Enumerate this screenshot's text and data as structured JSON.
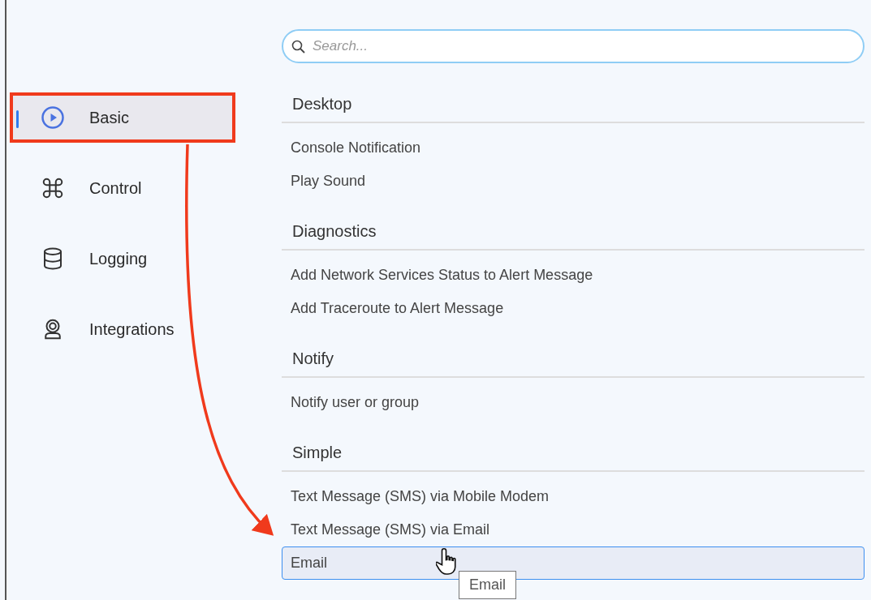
{
  "search": {
    "placeholder": "Search..."
  },
  "sidebar": {
    "items": [
      {
        "label": "Basic",
        "selected": true,
        "highlighted": true
      },
      {
        "label": "Control",
        "selected": false,
        "highlighted": false
      },
      {
        "label": "Logging",
        "selected": false,
        "highlighted": false
      },
      {
        "label": "Integrations",
        "selected": false,
        "highlighted": false
      }
    ]
  },
  "sections": [
    {
      "heading": "Desktop",
      "items": [
        {
          "label": "Console Notification",
          "selected": false
        },
        {
          "label": "Play Sound",
          "selected": false
        }
      ]
    },
    {
      "heading": "Diagnostics",
      "items": [
        {
          "label": "Add Network Services Status to Alert Message",
          "selected": false
        },
        {
          "label": "Add Traceroute to Alert Message",
          "selected": false
        }
      ]
    },
    {
      "heading": "Notify",
      "items": [
        {
          "label": "Notify user or group",
          "selected": false
        }
      ]
    },
    {
      "heading": "Simple",
      "items": [
        {
          "label": "Text Message (SMS) via Mobile Modem",
          "selected": false
        },
        {
          "label": "Text Message (SMS) via Email",
          "selected": false
        },
        {
          "label": "Email",
          "selected": true
        }
      ]
    }
  ],
  "tooltip": {
    "text": "Email"
  },
  "annotation": {
    "arrow": true
  }
}
